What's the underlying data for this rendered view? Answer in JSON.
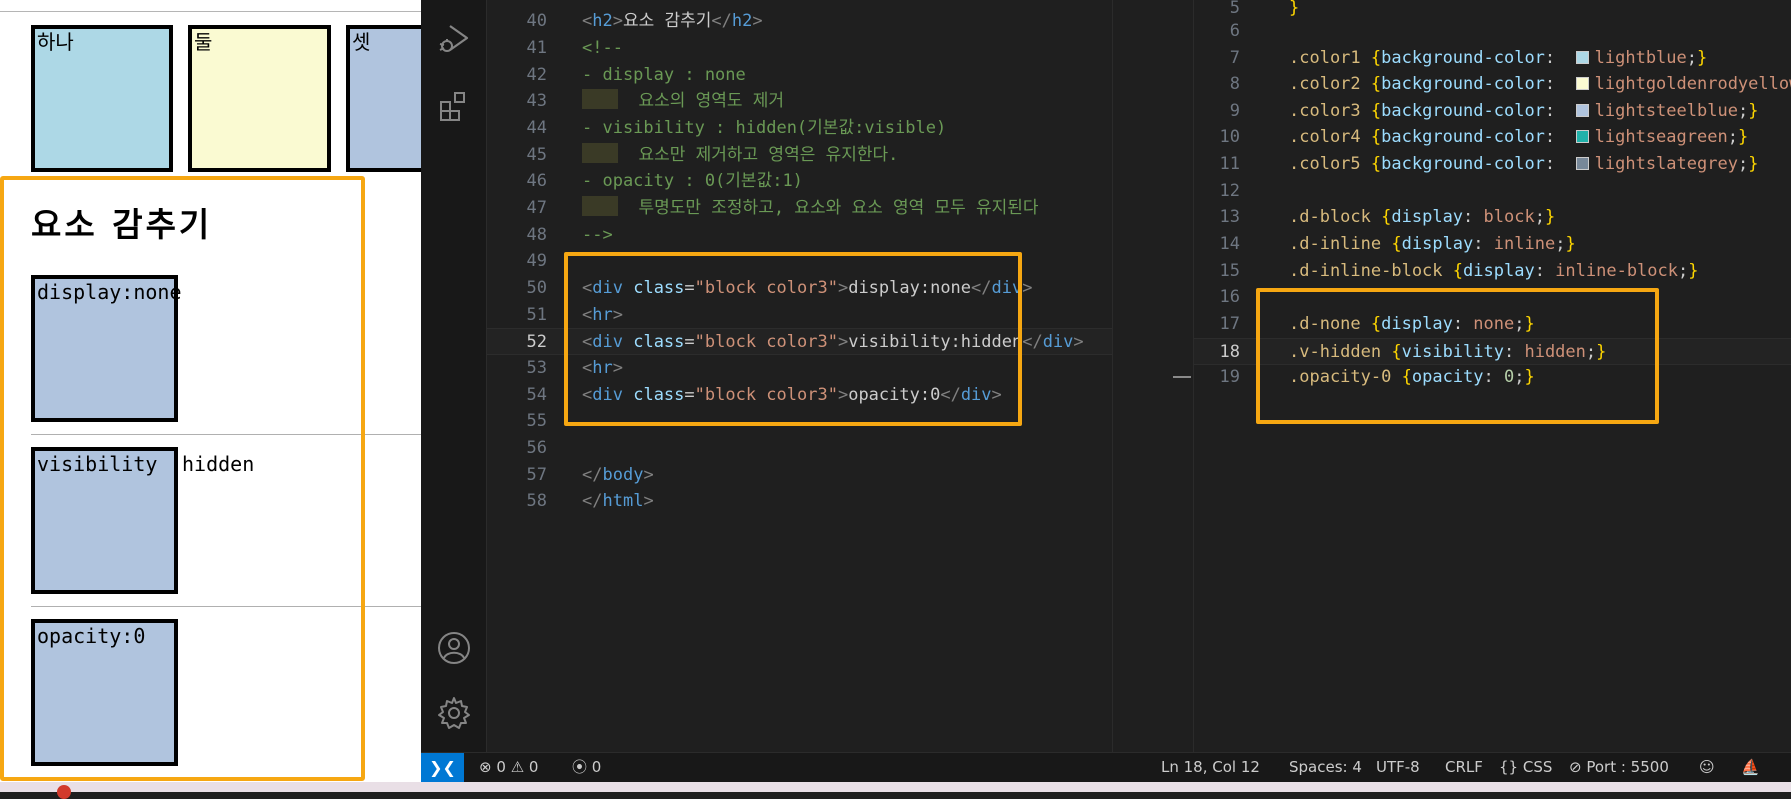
{
  "preview": {
    "top_boxes": [
      "하나",
      "둘",
      "셋"
    ],
    "title": "요소 감추기",
    "demos": [
      {
        "box_text": "display:none",
        "overflow": ""
      },
      {
        "box_text": "visibility",
        "overflow": "hidden"
      },
      {
        "box_text": "opacity:0",
        "overflow": ""
      }
    ]
  },
  "editor_html": {
    "lines": [
      {
        "n": "40"
      },
      {
        "n": "41"
      },
      {
        "n": "42"
      },
      {
        "n": "43"
      },
      {
        "n": "44"
      },
      {
        "n": "45"
      },
      {
        "n": "46"
      },
      {
        "n": "47"
      },
      {
        "n": "48"
      },
      {
        "n": "49"
      },
      {
        "n": "50"
      },
      {
        "n": "51"
      },
      {
        "n": "52"
      },
      {
        "n": "53"
      },
      {
        "n": "54"
      },
      {
        "n": "55"
      },
      {
        "n": "56"
      },
      {
        "n": "57"
      },
      {
        "n": "58"
      }
    ],
    "tag_h2": "h2",
    "h2_text": "요소 감추기",
    "comment_open": "<!--",
    "comment_1": "- display : none",
    "comment_1_sub": "요소의 영역도 제거",
    "comment_2": "- visibility : hidden(기본값:visible)",
    "comment_2_sub": "요소만 제거하고 영역은 유지한다.",
    "comment_3": "- opacity : 0(기본값:1)",
    "comment_3_sub": "투명도만 조정하고, 요소와 요소 영역 모두 유지된다",
    "comment_close": "-->",
    "tag_div": "div",
    "attr_class": "class",
    "class_value": "\"block color3\"",
    "div_texts": [
      "display:none",
      "visibility:hidden",
      "opacity:0"
    ],
    "tag_hr": "hr",
    "tag_body": "body",
    "tag_html": "html"
  },
  "editor_css": {
    "lines": [
      {
        "n": "5"
      },
      {
        "n": "6"
      },
      {
        "n": "7"
      },
      {
        "n": "8"
      },
      {
        "n": "9"
      },
      {
        "n": "10"
      },
      {
        "n": "11"
      },
      {
        "n": "12"
      },
      {
        "n": "13"
      },
      {
        "n": "14"
      },
      {
        "n": "15"
      },
      {
        "n": "16"
      },
      {
        "n": "17"
      },
      {
        "n": "18"
      },
      {
        "n": "19"
      }
    ],
    "closing_brace": "}",
    "colors": [
      {
        "selector": ".color1",
        "value": "lightblue",
        "hex": "#add8e6"
      },
      {
        "selector": ".color2",
        "value": "lightgoldenrodyellow",
        "hex": "#fafad2"
      },
      {
        "selector": ".color3",
        "value": "lightsteelblue",
        "hex": "#b0c4de"
      },
      {
        "selector": ".color4",
        "value": "lightseagreen",
        "hex": "#20b2aa"
      },
      {
        "selector": ".color5",
        "value": "lightslategrey",
        "hex": "#778899"
      }
    ],
    "color_prop": "background-color",
    "display_rules": [
      {
        "selector": ".d-block",
        "prop": "display",
        "value": "block"
      },
      {
        "selector": ".d-inline",
        "prop": "display",
        "value": "inline"
      },
      {
        "selector": ".d-inline-block",
        "prop": "display",
        "value": "inline-block"
      }
    ],
    "hide_rules": [
      {
        "selector": ".d-none",
        "prop": "display",
        "value": "none"
      },
      {
        "selector": ".v-hidden",
        "prop": "visibility",
        "value": "hidden"
      },
      {
        "selector": ".opacity-0",
        "prop": "opacity",
        "value": "0"
      }
    ]
  },
  "statusbar": {
    "remote_icon": "remote-icon",
    "errors": "0",
    "warnings": "0",
    "ports": "0",
    "cursor": "Ln 18, Col 12",
    "spaces": "Spaces: 4",
    "encoding": "UTF-8",
    "eol": "CRLF",
    "language": "CSS",
    "port": "Port : 5500"
  },
  "colors": {
    "highlight": "#f6a712",
    "editor_bg": "#1f1f1f",
    "status_accent": "#0078d4"
  }
}
